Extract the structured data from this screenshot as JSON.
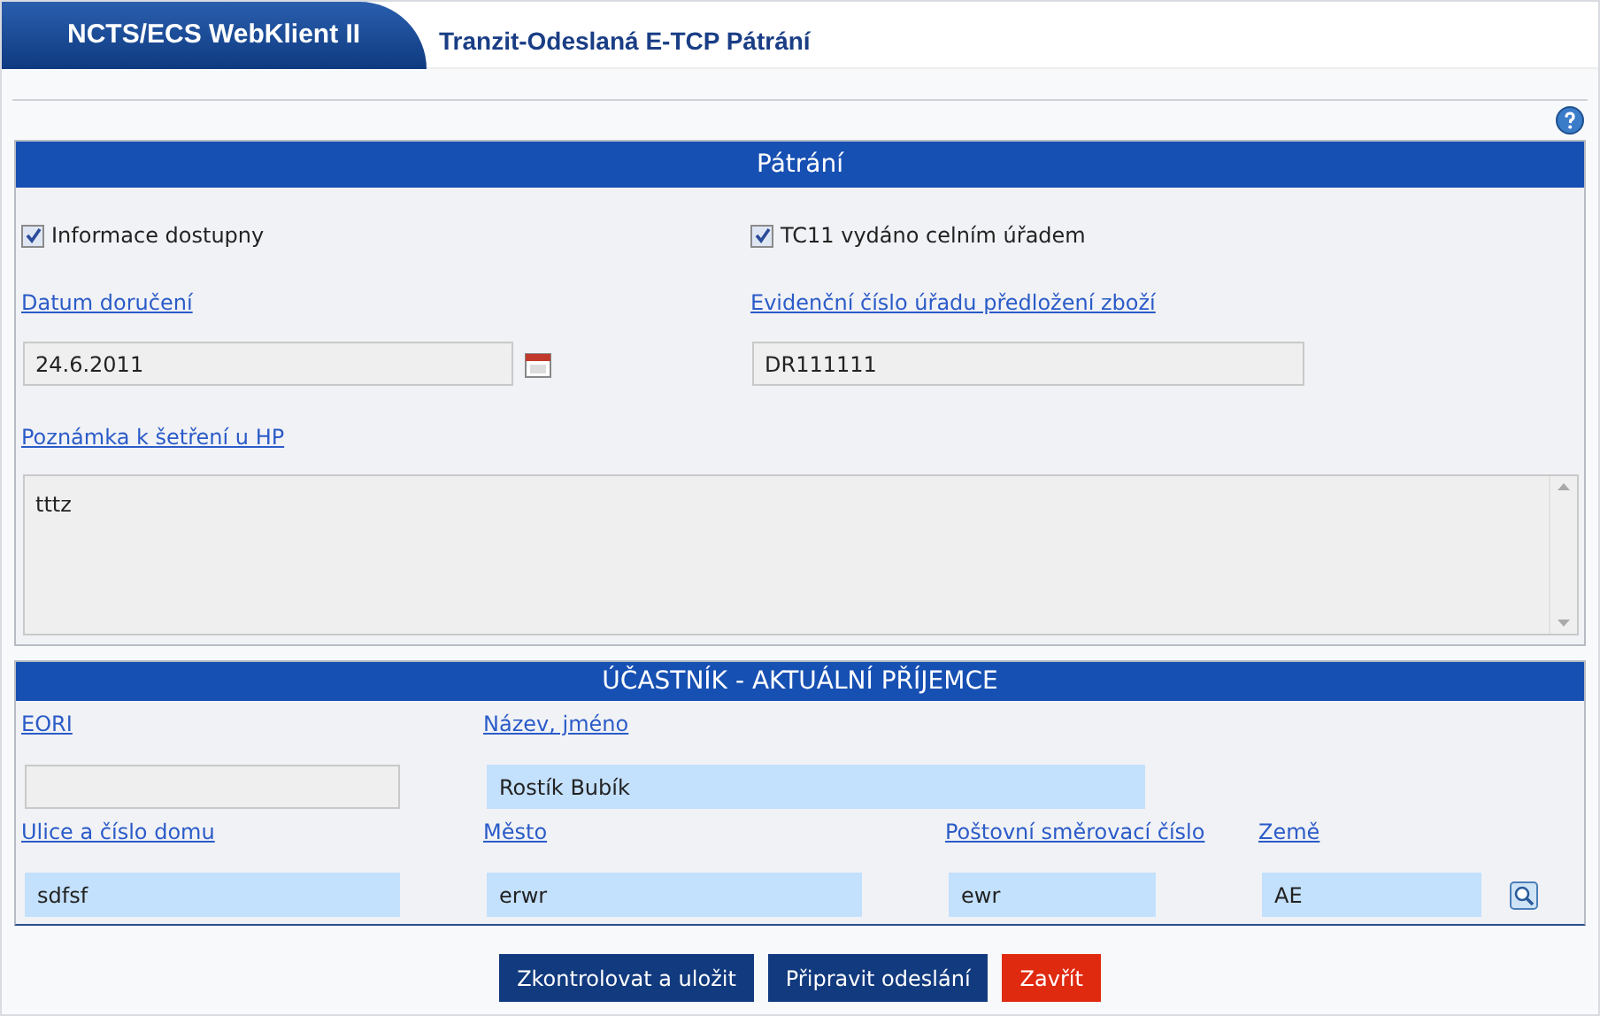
{
  "app_title": "NCTS/ECS WebKlient II",
  "page_title": "Tranzit-Odeslaná E-TCP Pátrání",
  "search_section": {
    "title": "Pátrání",
    "checkboxes": [
      {
        "label": "Informace dostupny",
        "checked": true
      },
      {
        "label": "TC11 vydáno celním úřadem",
        "checked": true
      }
    ],
    "fields": [
      {
        "label": "Datum doručení",
        "value": "24.6.2011",
        "kind": "date"
      },
      {
        "label": "Evidenční číslo úřadu předložení zboží",
        "value": "DR111111",
        "kind": "text"
      }
    ],
    "note": {
      "label": "Poznámka k šetření u HP",
      "value": "tttz"
    }
  },
  "participant_section": {
    "title": "ÚČASTNÍK - AKTUÁLNÍ PŘÍJEMCE",
    "rows": [
      [
        {
          "label": "EORI",
          "kind": "readonly"
        },
        {
          "label": "Název, jméno",
          "value": "Rostík Bubík",
          "kind": "wide"
        }
      ],
      [
        {
          "label": "Ulice a číslo domu",
          "value": "sdfsf",
          "kind": "text"
        },
        {
          "label": "Město",
          "value": "erwr",
          "kind": "text"
        },
        {
          "label": "Poštovní směrovací číslo",
          "value": "ewr",
          "kind": "short"
        },
        {
          "label": "Země",
          "value": "AE",
          "kind": "lookup"
        }
      ]
    ]
  },
  "buttons": [
    {
      "label": "Zkontrolovat a uložit",
      "kind": "primary"
    },
    {
      "label": "Připravit odeslání",
      "kind": "primary"
    },
    {
      "label": "Zavřít",
      "kind": "danger"
    }
  ]
}
